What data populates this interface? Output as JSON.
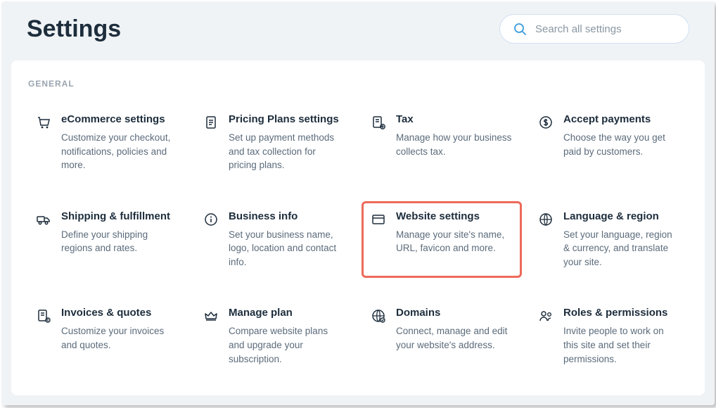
{
  "header": {
    "title": "Settings",
    "search_placeholder": "Search all settings"
  },
  "section": {
    "label": "GENERAL"
  },
  "cards": [
    {
      "name": "ecommerce-settings",
      "icon": "cart",
      "title": "eCommerce settings",
      "desc": "Customize your checkout, notifications, policies and more.",
      "highlight": false
    },
    {
      "name": "pricing-plans-settings",
      "icon": "file",
      "title": "Pricing Plans settings",
      "desc": "Set up payment methods and tax collection for pricing plans.",
      "highlight": false
    },
    {
      "name": "tax",
      "icon": "tax",
      "title": "Tax",
      "desc": "Manage how your business collects tax.",
      "highlight": false
    },
    {
      "name": "accept-payments",
      "icon": "dollar",
      "title": "Accept payments",
      "desc": "Choose the way you get paid by customers.",
      "highlight": false
    },
    {
      "name": "shipping-fulfillment",
      "icon": "truck",
      "title": "Shipping & fulfillment",
      "desc": "Define your shipping regions and rates.",
      "highlight": false
    },
    {
      "name": "business-info",
      "icon": "info",
      "title": "Business info",
      "desc": "Set your business name, logo, location and contact info.",
      "highlight": false
    },
    {
      "name": "website-settings",
      "icon": "browser",
      "title": "Website settings",
      "desc": "Manage your site's name, URL, favicon and more.",
      "highlight": true
    },
    {
      "name": "language-region",
      "icon": "globe",
      "title": "Language & region",
      "desc": "Set your language, region & currency, and translate your site.",
      "highlight": false
    },
    {
      "name": "invoices-quotes",
      "icon": "invoice",
      "title": "Invoices & quotes",
      "desc": "Customize your invoices and quotes.",
      "highlight": false
    },
    {
      "name": "manage-plan",
      "icon": "crown",
      "title": "Manage plan",
      "desc": "Compare website plans and upgrade your subscription.",
      "highlight": false
    },
    {
      "name": "domains",
      "icon": "domain",
      "title": "Domains",
      "desc": "Connect, manage and edit your website's address.",
      "highlight": false
    },
    {
      "name": "roles-permissions",
      "icon": "people",
      "title": "Roles & permissions",
      "desc": "Invite people to work on this site and set their permissions.",
      "highlight": false
    }
  ]
}
